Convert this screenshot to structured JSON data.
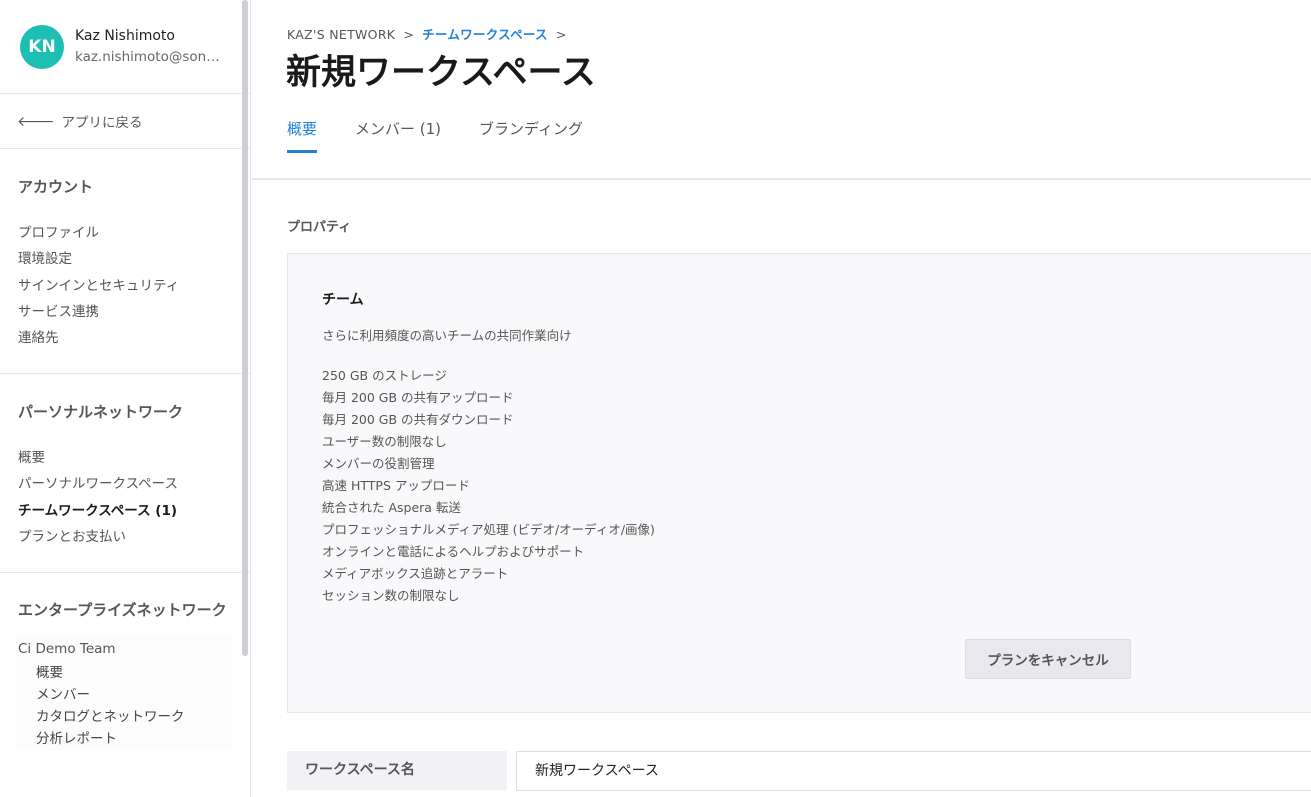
{
  "user": {
    "initials": "KN",
    "name": "Kaz Nishimoto",
    "email": "kaz.nishimoto@sonyoneco.com",
    "avatar_color": "#1cbfb2"
  },
  "sidebar": {
    "back_label": "アプリに戻る",
    "account": {
      "title": "アカウント",
      "items": [
        "プロファイル",
        "環境設定",
        "サインインとセキュリティ",
        "サービス連携",
        "連絡先"
      ]
    },
    "personal_network": {
      "title": "パーソナルネットワーク",
      "items": [
        "概要",
        "パーソナルワークスペース",
        "チームワークスペース (1)",
        "プランとお支払い"
      ],
      "active_index": 2
    },
    "enterprise_network": {
      "title": "エンタープライズネットワーク",
      "team_name": "Ci Demo Team",
      "sub_items": [
        "概要",
        "メンバー",
        "カタログとネットワーク",
        "分析レポート"
      ]
    }
  },
  "breadcrumb": {
    "root": "KAZ'S NETWORK",
    "link": "チームワークスペース",
    "separator": ">"
  },
  "page": {
    "title": "新規ワークスペース",
    "tabs": [
      "概要",
      "メンバー (1)",
      "ブランディング"
    ],
    "active_tab": 0,
    "accent_color": "#1f82d8"
  },
  "properties": {
    "label": "プロパティ",
    "plan": {
      "name": "チーム",
      "description": "さらに利用頻度の高いチームの共同作業向け",
      "features": [
        "250 GB のストレージ",
        "毎月 200 GB の共有アップロード",
        "毎月 200 GB の共有ダウンロード",
        "ユーザー数の制限なし",
        "メンバーの役割管理",
        "高速 HTTPS アップロード",
        "統合された Aspera 転送",
        "プロフェッショナルメディア処理 (ビデオ/オーディオ/画像)",
        "オンラインと電話によるヘルプおよびサポート",
        "メディアボックス追跡とアラート",
        "セッション数の制限なし"
      ],
      "cancel_label": "プランをキャンセル"
    },
    "workspace_name_label": "ワークスペース名",
    "workspace_name_value": "新規ワークスペース"
  }
}
